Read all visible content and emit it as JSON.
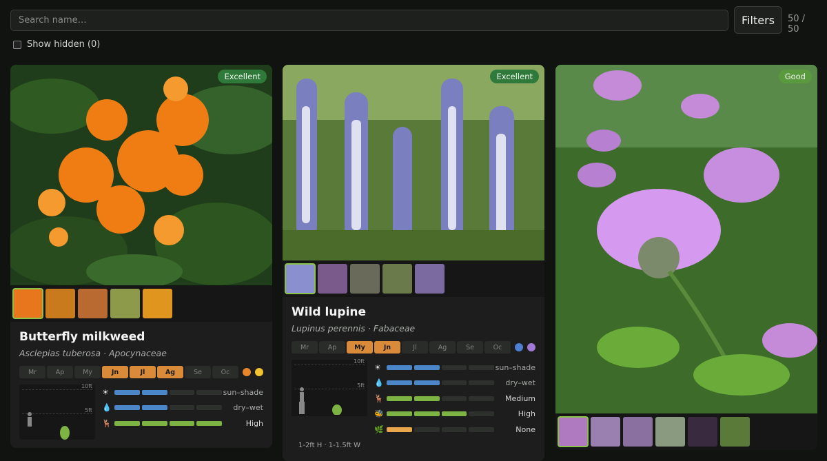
{
  "toolbar": {
    "search_placeholder": "Search name…",
    "filters_label": "Filters",
    "count": "50 / 50",
    "show_hidden": "Show hidden (0)"
  },
  "cards": [
    {
      "badge": "Excellent",
      "name": "Butterfly milkweed",
      "latin": "Asclepias tuberosa · Apocynaceae",
      "months": [
        "Mr",
        "Ap",
        "My",
        "Jn",
        "Jl",
        "Ag",
        "Se",
        "Oc"
      ],
      "bloom_months": [
        "Jn",
        "Jl",
        "Ag"
      ],
      "flower_colors": [
        "#e8842a",
        "#f2c230"
      ],
      "height_ticks": [
        "10ft",
        "5ft"
      ],
      "bars": [
        {
          "icon": "sun-icon",
          "glyph": "☀",
          "fill": 2,
          "color": "#4a86c8",
          "label": "sun–shade"
        },
        {
          "icon": "water-drop-icon",
          "glyph": "💧",
          "fill": 2,
          "color": "#4a86c8",
          "label": "dry–wet"
        },
        {
          "icon": "deer-icon",
          "glyph": "🦌",
          "fill": 4,
          "color": "#7cb342",
          "label": "High"
        }
      ]
    },
    {
      "badge": "Excellent",
      "name": "Wild lupine",
      "latin": "Lupinus perennis · Fabaceae",
      "months": [
        "Mr",
        "Ap",
        "My",
        "Jn",
        "Jl",
        "Ag",
        "Se",
        "Oc"
      ],
      "bloom_months": [
        "My",
        "Jn"
      ],
      "flower_colors": [
        "#4e7fd0",
        "#a07ad6"
      ],
      "height_ticks": [
        "10ft",
        "5ft"
      ],
      "dimensions": "1-2ft H · 1-1.5ft W",
      "bars": [
        {
          "icon": "sun-icon",
          "glyph": "☀",
          "fill": 2,
          "color": "#4a86c8",
          "label": "sun–shade"
        },
        {
          "icon": "water-drop-icon",
          "glyph": "💧",
          "fill": 2,
          "color": "#4a86c8",
          "label": "dry–wet"
        },
        {
          "icon": "deer-icon",
          "glyph": "🦌",
          "fill": 2,
          "color": "#7cb342",
          "label": "Medium"
        },
        {
          "icon": "bee-icon",
          "glyph": "🐝",
          "fill": 3,
          "color": "#7cb342",
          "label": "High"
        },
        {
          "icon": "leaf-icon",
          "glyph": "🌿",
          "fill": 1,
          "color": "#e8a74a",
          "label": "None"
        }
      ]
    },
    {
      "badge": "Good"
    }
  ]
}
